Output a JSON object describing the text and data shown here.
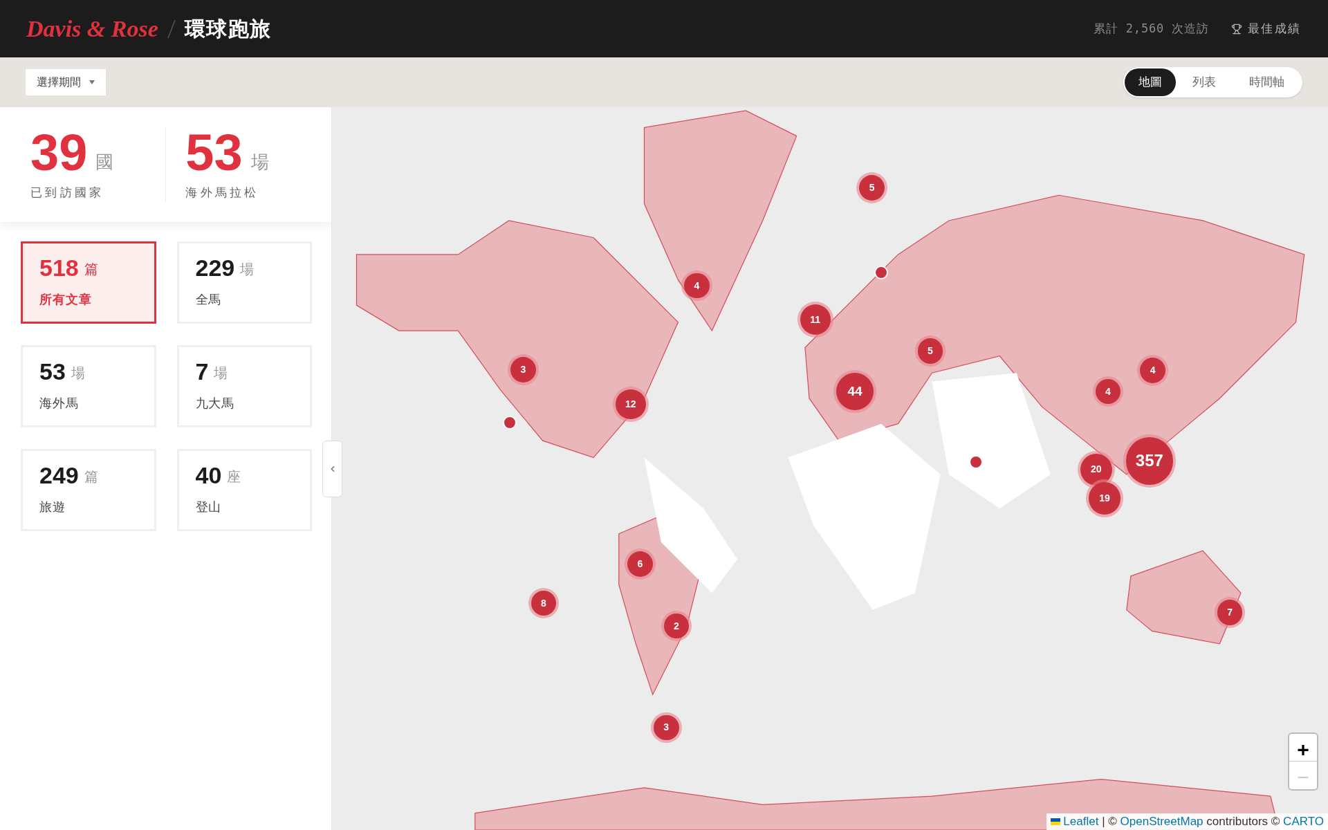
{
  "header": {
    "brand": "Davis & Rose",
    "title": "環球跑旅",
    "visits": "累計 2,560 次造訪",
    "best": "最佳成績"
  },
  "period_select": {
    "label": "選擇期間"
  },
  "view_tabs": [
    {
      "label": "地圖",
      "selected": true
    },
    {
      "label": "列表",
      "selected": false
    },
    {
      "label": "時間軸",
      "selected": false
    }
  ],
  "summary": [
    {
      "value": "39",
      "unit": "國",
      "label": "已到訪國家"
    },
    {
      "value": "53",
      "unit": "場",
      "label": "海外馬拉松"
    }
  ],
  "categories": [
    {
      "value": "518",
      "unit": "篇",
      "label": "所有文章",
      "selected": true
    },
    {
      "value": "229",
      "unit": "場",
      "label": "全馬",
      "selected": false
    },
    {
      "value": "53",
      "unit": "場",
      "label": "海外馬",
      "selected": false
    },
    {
      "value": "7",
      "unit": "場",
      "label": "九大馬",
      "selected": false
    },
    {
      "value": "249",
      "unit": "篇",
      "label": "旅遊",
      "selected": false
    },
    {
      "value": "40",
      "unit": "座",
      "label": "登山",
      "selected": false
    }
  ],
  "map": {
    "markers": [
      {
        "count": "5"
      },
      {
        "count": "4"
      },
      {
        "count": "11"
      },
      {
        "count": "5"
      },
      {
        "count": "3"
      },
      {
        "count": "12"
      },
      {
        "count": "44"
      },
      {
        "count": "4"
      },
      {
        "count": "4"
      },
      {
        "count": "20"
      },
      {
        "count": "357"
      },
      {
        "count": "19"
      },
      {
        "count": "6"
      },
      {
        "count": "8"
      },
      {
        "count": "2"
      },
      {
        "count": "7"
      },
      {
        "count": "3"
      }
    ],
    "zoom": {
      "zoom_in": "+",
      "zoom_out": "−",
      "zoom_out_disabled": true
    },
    "attribution": {
      "leaflet": "Leaflet",
      "sep": "| ©",
      "osm": "OpenStreetMap",
      "contributors": "contributors ©",
      "carto": "CARTO"
    }
  }
}
